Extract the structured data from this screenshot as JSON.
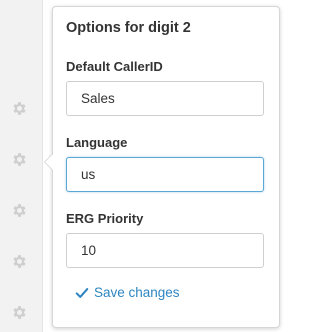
{
  "popover": {
    "title": "Options for digit 2",
    "default_callerid": {
      "label": "Default CallerID",
      "value": "Sales"
    },
    "language": {
      "label": "Language",
      "value": "us"
    },
    "erg_priority": {
      "label": "ERG Priority",
      "value": "10"
    },
    "save_label": "Save changes"
  },
  "colors": {
    "accent": "#2e86c1",
    "focus_border": "#5aa6d6",
    "gear": "#cfcfcf",
    "strip_bg": "#f2f2f2"
  },
  "icons": {
    "row_icon": "gear-icon",
    "save_icon": "check-icon"
  }
}
